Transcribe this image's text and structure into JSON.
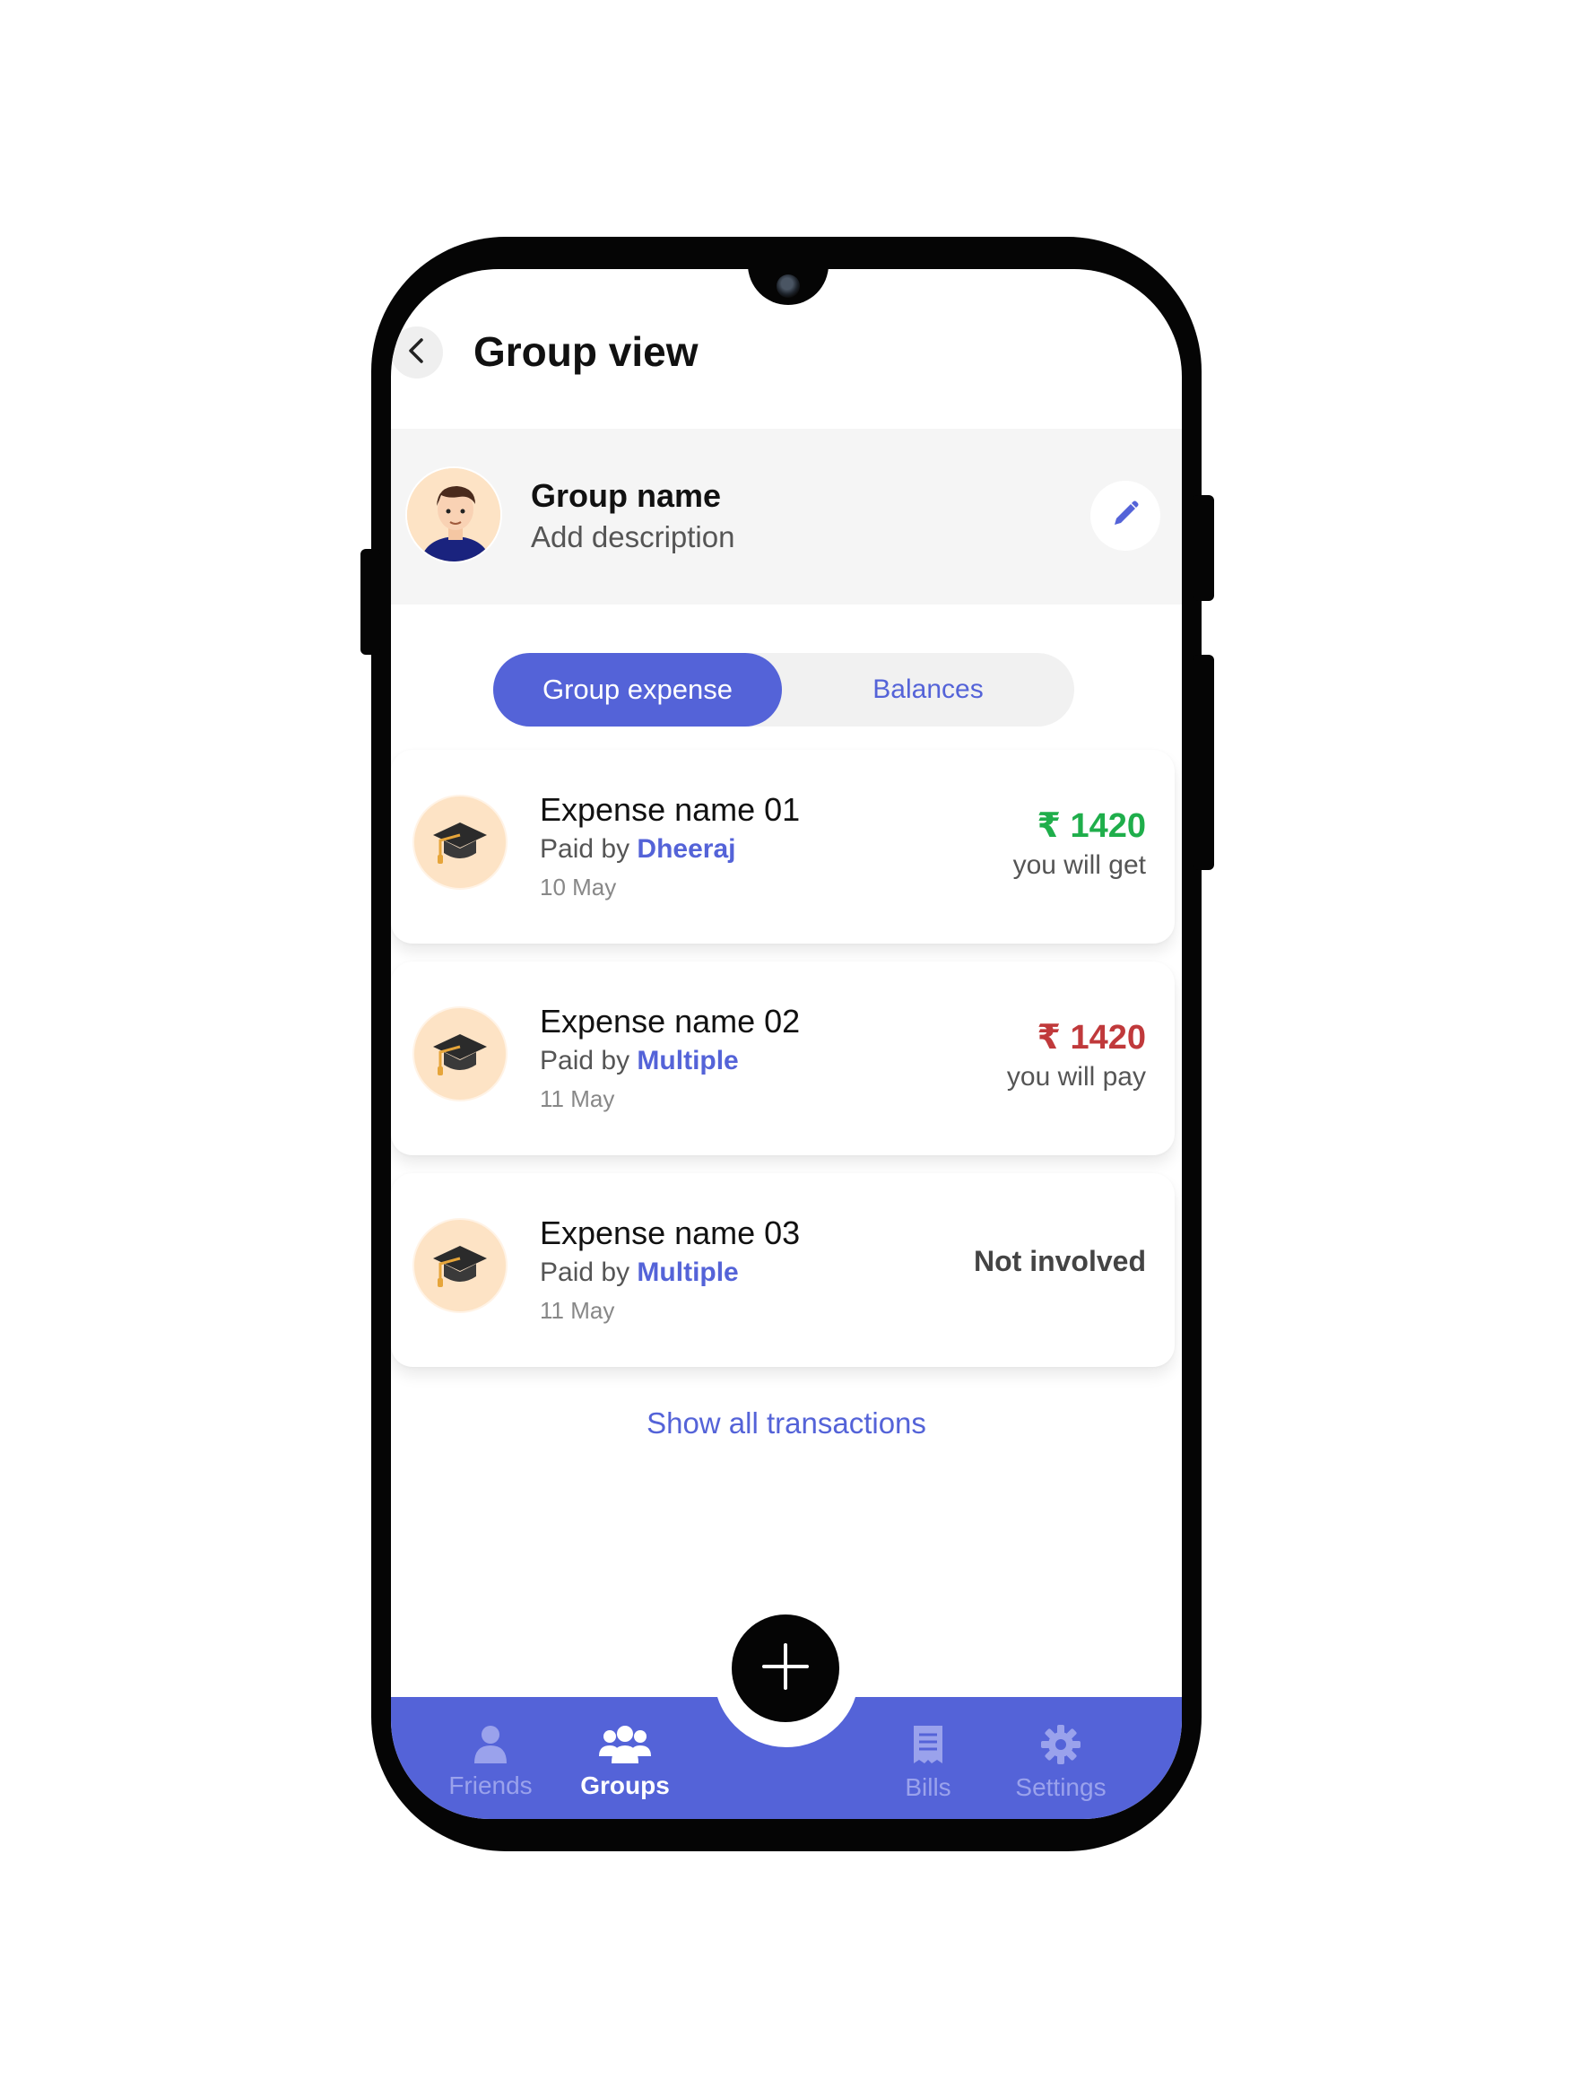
{
  "header": {
    "title": "Group view"
  },
  "group": {
    "name": "Group name",
    "description": "Add description"
  },
  "tabs": [
    {
      "label": "Group expense",
      "active": true
    },
    {
      "label": "Balances",
      "active": false
    }
  ],
  "expenses": [
    {
      "name": "Expense name 01",
      "paid_by_label": "Paid by",
      "payer": "Dheeraj",
      "date": "10 May",
      "amount": "₹ 1420",
      "status": "you will get",
      "amount_color": "#1fae4b"
    },
    {
      "name": "Expense name 02",
      "paid_by_label": "Paid by",
      "payer": "Multiple",
      "date": "11 May",
      "amount": "₹ 1420",
      "status": "you will pay",
      "amount_color": "#c0393b"
    },
    {
      "name": "Expense name 03",
      "paid_by_label": "Paid by",
      "payer": "Multiple",
      "date": "11 May",
      "status": "Not involved"
    }
  ],
  "show_all_label": "Show all transactions",
  "bottom_nav": [
    {
      "label": "Friends",
      "icon": "person-icon",
      "active": false
    },
    {
      "label": "Groups",
      "icon": "groups-icon",
      "active": true
    },
    {
      "label": "Bills",
      "icon": "receipt-icon",
      "active": false
    },
    {
      "label": "Settings",
      "icon": "gear-icon",
      "active": false
    }
  ],
  "fab_icon": "plus-icon",
  "colors": {
    "accent": "#5463d8",
    "positive": "#1fae4b",
    "negative": "#c0393b"
  }
}
